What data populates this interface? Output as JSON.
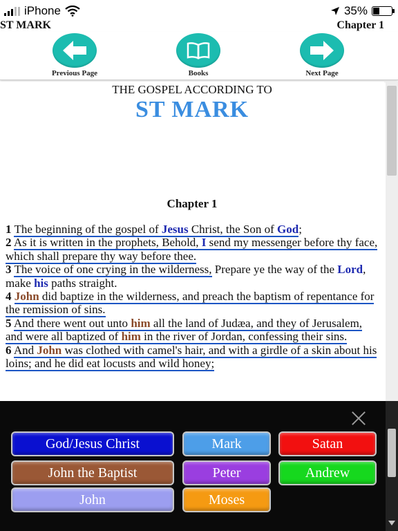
{
  "status_bar": {
    "carrier": "iPhone",
    "battery_percent": "35%",
    "battery_level": 0.35
  },
  "header": {
    "book": "ST MARK",
    "chapter": "Chapter 1"
  },
  "nav": {
    "prev_label": "Previous Page",
    "books_label": "Books",
    "next_label": "Next Page"
  },
  "content": {
    "subtitle": "THE GOSPEL ACCORDING TO",
    "title": "ST MARK",
    "chapter_heading": "Chapter 1"
  },
  "verses": [
    {
      "num": "1",
      "parts": [
        {
          "t": "The beginning of the gospel of ",
          "h": true
        },
        {
          "t": "Jesus",
          "h": true,
          "c": "god"
        },
        {
          "t": " Christ, the Son of ",
          "h": true
        },
        {
          "t": "God",
          "h": true,
          "c": "god"
        },
        {
          "t": ";"
        }
      ]
    },
    {
      "num": "2",
      "parts": [
        {
          "t": "As it is written in the prophets, ",
          "h": true
        },
        {
          "t": "Behold, ",
          "h": true
        },
        {
          "t": "I",
          "h": true,
          "c": "god"
        },
        {
          "t": " send my messenger before thy face, which shall prepare thy way before thee.",
          "h": true
        }
      ]
    },
    {
      "num": "3",
      "parts": [
        {
          "t": "The voice of one crying in the wilderness,",
          "h": true
        },
        {
          "t": " Prepare ye the way of the "
        },
        {
          "t": "Lord",
          "c": "god"
        },
        {
          "t": ", make "
        },
        {
          "t": "his",
          "c": "god"
        },
        {
          "t": " paths straight."
        }
      ]
    },
    {
      "num": "4",
      "parts": [
        {
          "t": "John",
          "h": true,
          "c": "john"
        },
        {
          "t": " did baptize in the wilderness, and preach the baptism of repentance for the remission of sins.",
          "h": true
        }
      ]
    },
    {
      "num": "5",
      "parts": [
        {
          "t": "And there went out unto ",
          "h": true
        },
        {
          "t": "him",
          "h": true,
          "c": "john"
        },
        {
          "t": " all the land of Judæa, and they of Jerusalem, and were all baptized of ",
          "h": true
        },
        {
          "t": "him",
          "h": true,
          "c": "john"
        },
        {
          "t": " in the river of Jordan, confessing their sins.",
          "h": true
        }
      ]
    },
    {
      "num": "6",
      "parts": [
        {
          "t": "And ",
          "h": true
        },
        {
          "t": "John",
          "h": true,
          "c": "john"
        },
        {
          "t": " was clothed with camel's hair, and with a girdle of a skin about his loins; and he did eat locusts and wild honey;",
          "h": true
        }
      ]
    }
  ],
  "legend": [
    {
      "label": "God/Jesus Christ",
      "color": "#0a10d0"
    },
    {
      "label": "Mark",
      "color": "#4d9ee8"
    },
    {
      "label": "Satan",
      "color": "#f21010"
    },
    {
      "label": "John the Baptist",
      "color": "#9a5836"
    },
    {
      "label": "Peter",
      "color": "#9a3ee0"
    },
    {
      "label": "Andrew",
      "color": "#16d81e"
    },
    {
      "label": "John",
      "color": "#9c9ef0"
    },
    {
      "label": "Moses",
      "color": "#f59a12"
    }
  ]
}
